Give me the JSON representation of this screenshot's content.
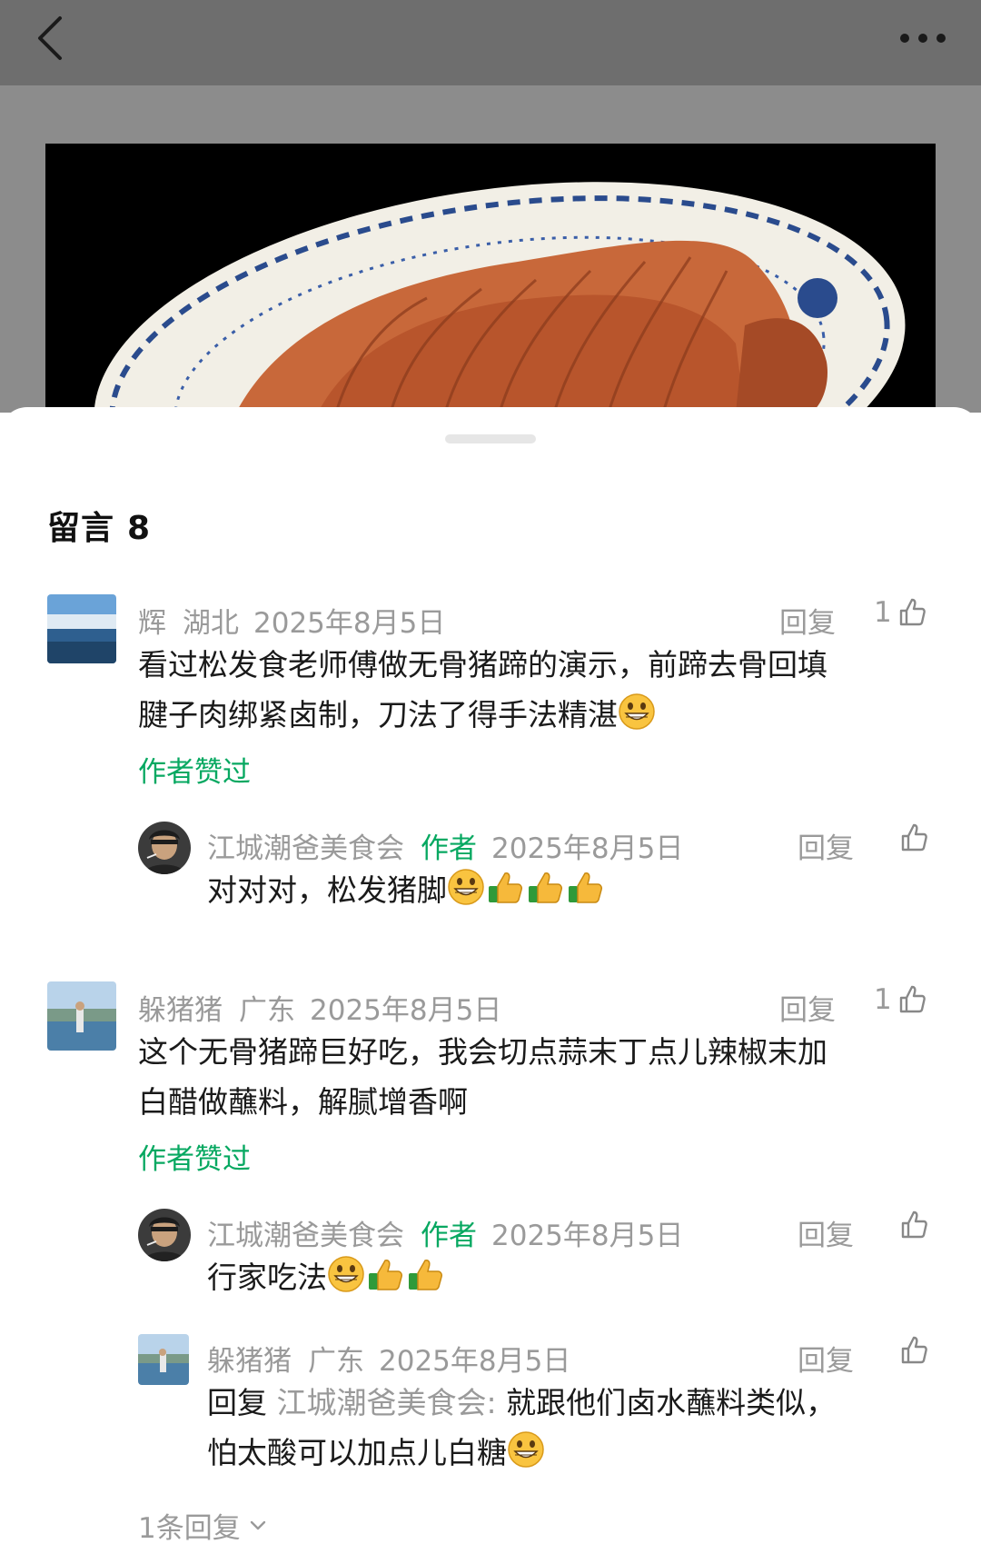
{
  "sheet": {
    "title_label": "留言",
    "count": "8"
  },
  "comments": [
    {
      "name": "辉",
      "region": "湖北",
      "date": "2025年8月5日",
      "reply_label": "回复",
      "likes": "1",
      "text_1": "看过松发食老师傅做无骨猪蹄的演示，前蹄去骨回填",
      "text_2": "腱子肉绑紧卤制，刀法了得手法精湛",
      "liked_by_author": "作者赞过",
      "reply": {
        "name": "江城潮爸美食会",
        "author_tag": "作者",
        "date": "2025年8月5日",
        "reply_label": "回复",
        "text": "对对对，松发猪脚"
      }
    },
    {
      "name": "躲猪猪",
      "region": "广东",
      "date": "2025年8月5日",
      "reply_label": "回复",
      "likes": "1",
      "text_1": "这个无骨猪蹄巨好吃，我会切点蒜末丁点儿辣椒末加",
      "text_2": "白醋做蘸料，解腻增香啊",
      "liked_by_author": "作者赞过",
      "reply": {
        "name": "江城潮爸美食会",
        "author_tag": "作者",
        "date": "2025年8月5日",
        "reply_label": "回复",
        "text": "行家吃法"
      },
      "reply2": {
        "name": "躲猪猪",
        "region": "广东",
        "date": "2025年8月5日",
        "reply_label": "回复",
        "reply_prefix": "回复",
        "quoted_user": "江城潮爸美食会:",
        "text_1": "就跟他们卤水蘸料类似，",
        "text_2": "怕太酸可以加点儿白糖"
      },
      "more_replies": "1条回复"
    }
  ],
  "icons": {
    "back": "back-arrow-icon",
    "more": "more-dots-icon",
    "like": "thumbs-up-icon",
    "grin": "grinning-emoji",
    "thumbs": "thumbs-up-emoji"
  },
  "colors": {
    "accent_green": "#07a861",
    "meta_gray": "#9a9a9a",
    "text": "#1a1a1a"
  }
}
